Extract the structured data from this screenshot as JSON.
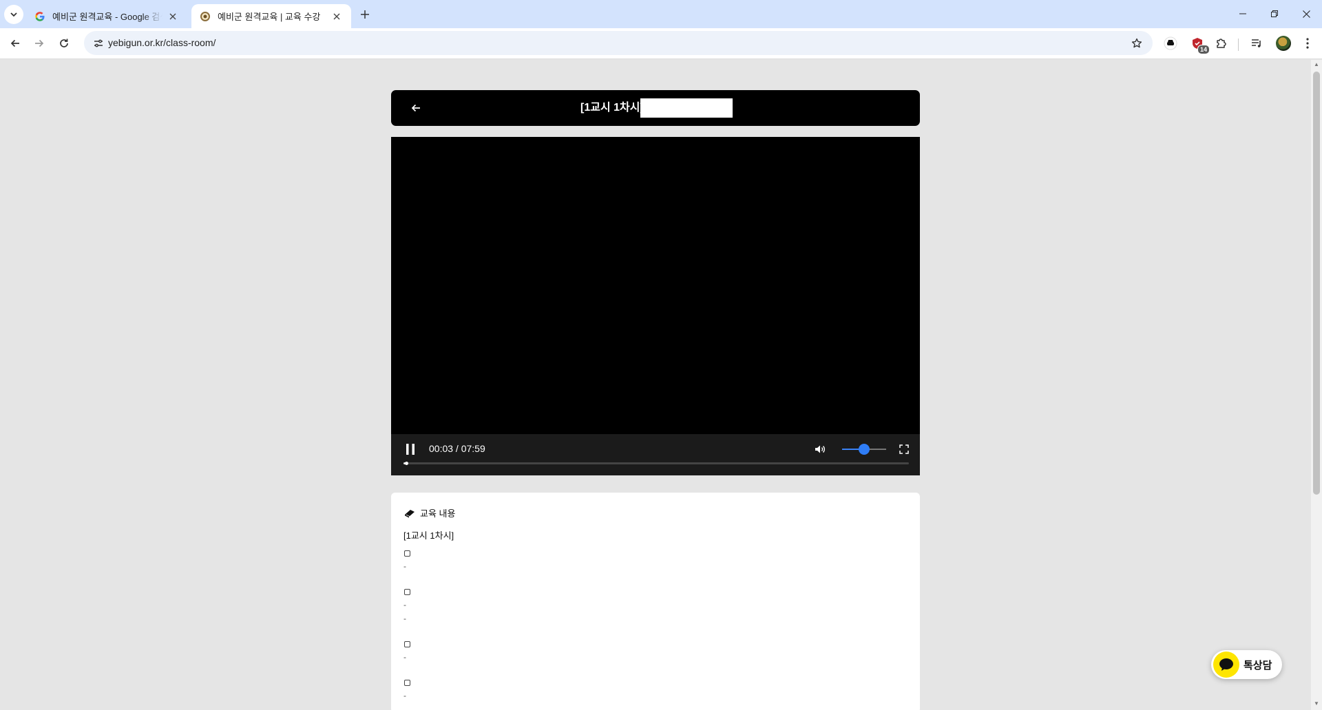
{
  "browser": {
    "tabs": [
      {
        "title": "예비군 원격교육 - Google 검색"
      },
      {
        "title": "예비군 원격교육 | 교육 수강"
      }
    ],
    "url": "yebigun.or.kr/class-room/",
    "extension_badge": "14"
  },
  "page": {
    "header": {
      "title": "[1교시 1차시]"
    },
    "video": {
      "time_display": "00:03 / 07:59",
      "progress": 0.006,
      "volume": 0.5,
      "state": "playing"
    },
    "content": {
      "section_label": "교육 내용",
      "lesson_subtitle": "[1교시 1차시]",
      "items": [
        {
          "dashes": [
            "-"
          ]
        },
        {
          "dashes": [
            "-",
            "-"
          ]
        },
        {
          "dashes": [
            "-"
          ]
        },
        {
          "dashes": [
            "-"
          ]
        }
      ]
    },
    "chat": {
      "label": "톡상담"
    }
  },
  "colors": {
    "tab_strip": "#d3e3fd",
    "accent_blue": "#2f7df6",
    "kakao_yellow": "#fee500"
  }
}
